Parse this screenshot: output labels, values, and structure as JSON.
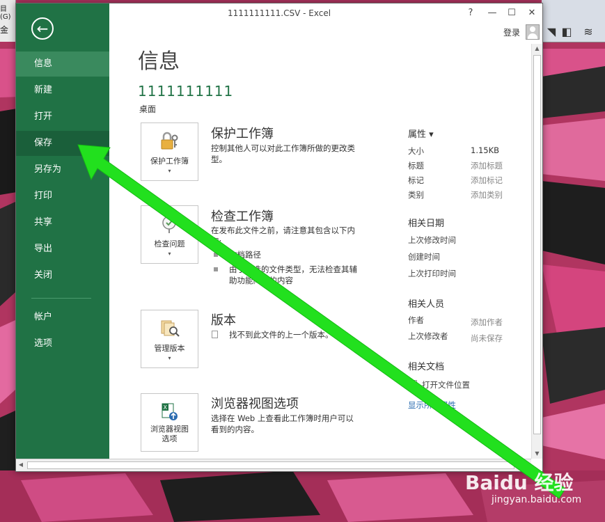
{
  "window": {
    "title": "1111111111.CSV - Excel",
    "help": "?",
    "minimize": "—",
    "maximize": "☐",
    "close": "✕",
    "login": "登录"
  },
  "background": {
    "fragment_top": "目(G)",
    "fragment_mid": "金"
  },
  "sidebar": {
    "back_icon": "←",
    "items": [
      {
        "label": "信息"
      },
      {
        "label": "新建"
      },
      {
        "label": "打开"
      },
      {
        "label": "保存"
      },
      {
        "label": "另存为"
      },
      {
        "label": "打印"
      },
      {
        "label": "共享"
      },
      {
        "label": "导出"
      },
      {
        "label": "关闭"
      },
      {
        "label": "帐户"
      },
      {
        "label": "选项"
      }
    ]
  },
  "info": {
    "title": "信息",
    "filename": "1111111111",
    "location": "桌面",
    "sections": {
      "protect": {
        "tile": "保护工作簿",
        "heading": "保护工作簿",
        "text": "控制其他人可以对此工作簿所做的更改类型。"
      },
      "inspect": {
        "tile": "检查问题",
        "heading": "检查工作簿",
        "text": "在发布此文件之前，请注意其包含以下内容:",
        "bullets": [
          "文档路径",
          "由于所选的文件类型，无法检查其辅助功能问题的内容"
        ]
      },
      "versions": {
        "tile": "管理版本",
        "heading": "版本",
        "text": "找不到此文件的上一个版本。"
      },
      "browser": {
        "tile_line1": "浏览器视图",
        "tile_line2": "选项",
        "heading": "浏览器视图选项",
        "text": "选择在 Web 上查看此工作簿时用户可以看到的内容。"
      }
    },
    "caret": "▾"
  },
  "properties": {
    "heading": "属性 ▾",
    "rows": [
      {
        "key": "大小",
        "value": "1.15KB"
      },
      {
        "key": "标题",
        "value": "添加标题"
      },
      {
        "key": "标记",
        "value": "添加标记"
      },
      {
        "key": "类别",
        "value": "添加类别"
      }
    ],
    "dates_heading": "相关日期",
    "dates": [
      "上次修改时间",
      "创建时间",
      "上次打印时间"
    ],
    "people_heading": "相关人员",
    "people": [
      {
        "key": "作者",
        "value": "添加作者"
      },
      {
        "key": "上次修改者",
        "value": "尚未保存"
      }
    ],
    "docs_heading": "相关文档",
    "open_location": "打开文件位置",
    "show_all": "显示所有属性"
  },
  "watermark": {
    "logo": "Baidu 经验",
    "url": "jingyan.baidu.com"
  },
  "colors": {
    "excel_green": "#207245",
    "arrow": "#22e01e"
  }
}
